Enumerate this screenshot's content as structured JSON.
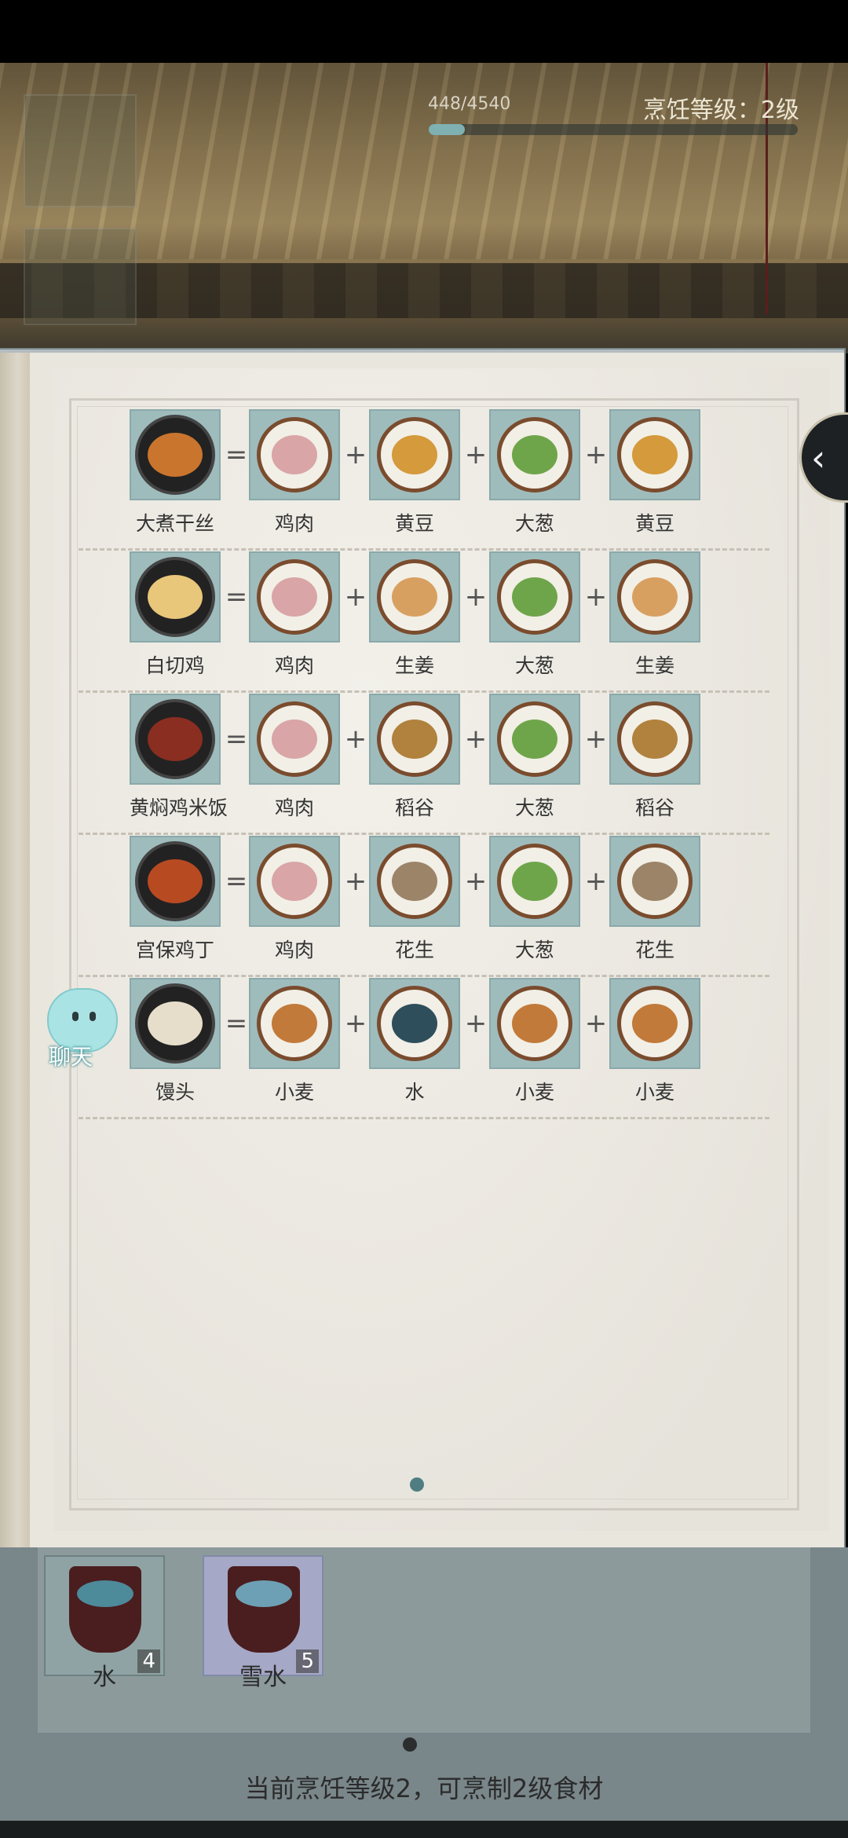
{
  "header": {
    "xp_text": "448/4540",
    "xp_fraction": 0.0987,
    "level_text": "烹饪等级：2级"
  },
  "recipes": [
    {
      "dish": "大煮干丝",
      "ingredients": [
        "鸡肉",
        "黄豆",
        "大葱",
        "黄豆"
      ]
    },
    {
      "dish": "白切鸡",
      "ingredients": [
        "鸡肉",
        "生姜",
        "大葱",
        "生姜"
      ]
    },
    {
      "dish": "黄焖鸡米饭",
      "ingredients": [
        "鸡肉",
        "稻谷",
        "大葱",
        "稻谷"
      ]
    },
    {
      "dish": "宫保鸡丁",
      "ingredients": [
        "鸡肉",
        "花生",
        "大葱",
        "花生"
      ]
    },
    {
      "dish": "馒头",
      "ingredients": [
        "小麦",
        "水",
        "小麦",
        "小麦"
      ]
    }
  ],
  "operators": {
    "equals": "=",
    "plus": "+"
  },
  "chat": {
    "label": "聊天"
  },
  "side_tab": {
    "icon": "chevron-left-icon",
    "glyph": "‹"
  },
  "inventory": {
    "items": [
      {
        "label": "水",
        "count": "4"
      },
      {
        "label": "雪水",
        "count": "5"
      }
    ],
    "status": "当前烹饪等级2，可烹制2级食材"
  },
  "colors": {
    "tile": "#9fbcbd",
    "page": "#e9e6de",
    "accent": "#4f7d82"
  }
}
